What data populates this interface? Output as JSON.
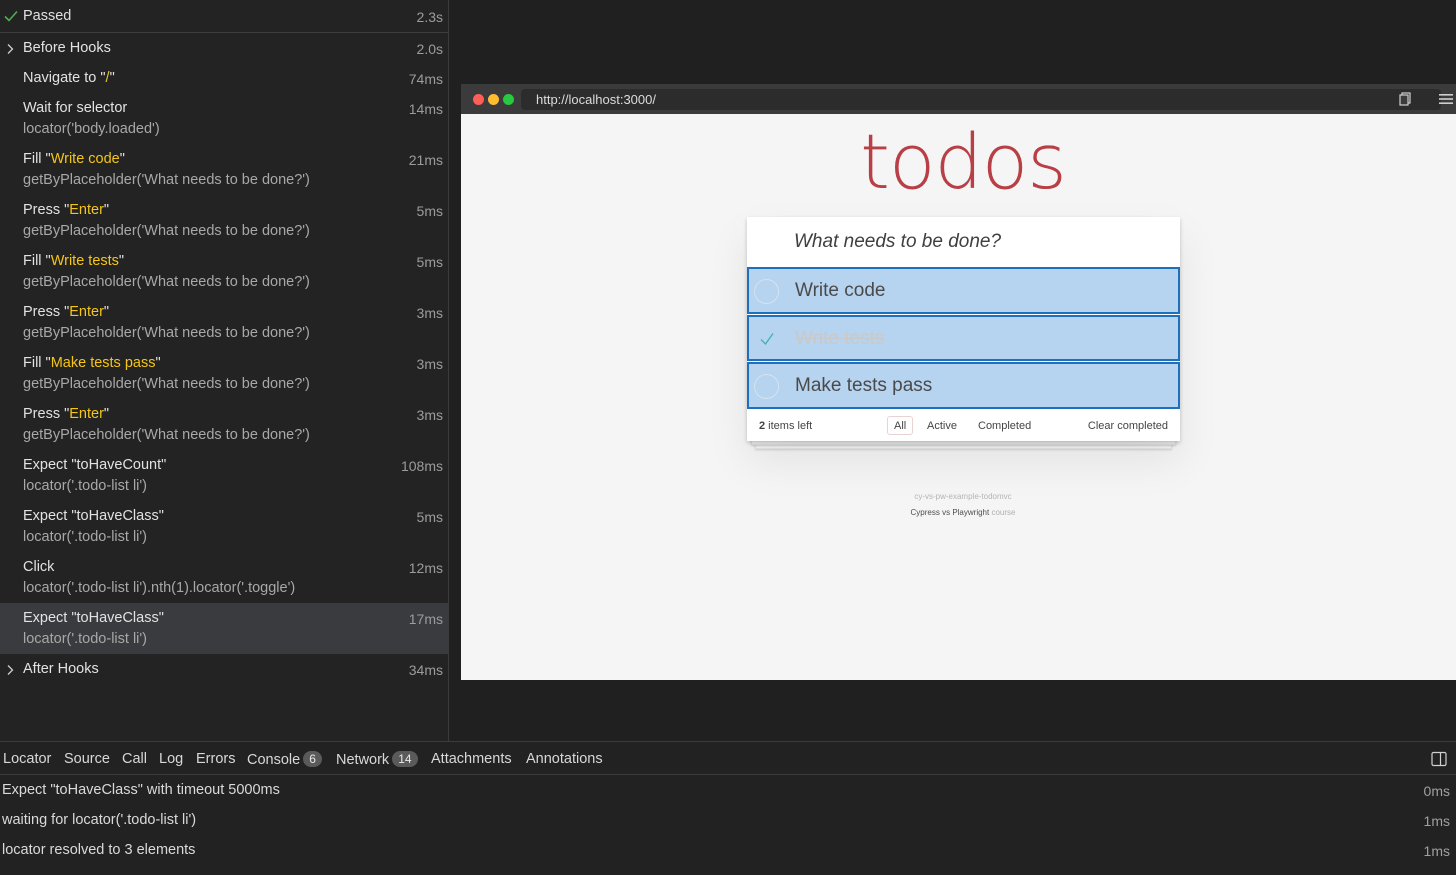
{
  "status": {
    "label": "Passed",
    "duration": "2.3s",
    "color": "#4caf50"
  },
  "actions": [
    {
      "title": "Before Hooks",
      "duration": "2.0s",
      "expandable": true
    },
    {
      "title_parts": [
        "Navigate to \"",
        "/",
        "\""
      ],
      "duration": "74ms"
    },
    {
      "title": "Wait for selector",
      "sub": "locator('body.loaded')",
      "duration": "14ms"
    },
    {
      "title_parts": [
        "Fill \"",
        "Write code",
        "\""
      ],
      "sub": "getByPlaceholder('What needs to be done?')",
      "duration": "21ms"
    },
    {
      "title_parts": [
        "Press \"",
        "Enter",
        "\""
      ],
      "sub": "getByPlaceholder('What needs to be done?')",
      "duration": "5ms"
    },
    {
      "title_parts": [
        "Fill \"",
        "Write tests",
        "\""
      ],
      "sub": "getByPlaceholder('What needs to be done?')",
      "duration": "5ms"
    },
    {
      "title_parts": [
        "Press \"",
        "Enter",
        "\""
      ],
      "sub": "getByPlaceholder('What needs to be done?')",
      "duration": "3ms"
    },
    {
      "title_parts": [
        "Fill \"",
        "Make tests pass",
        "\""
      ],
      "sub": "getByPlaceholder('What needs to be done?')",
      "duration": "3ms"
    },
    {
      "title_parts": [
        "Press \"",
        "Enter",
        "\""
      ],
      "sub": "getByPlaceholder('What needs to be done?')",
      "duration": "3ms"
    },
    {
      "title": "Expect \"toHaveCount\"",
      "sub": "locator('.todo-list li')",
      "duration": "108ms"
    },
    {
      "title": "Expect \"toHaveClass\"",
      "sub": "locator('.todo-list li')",
      "duration": "5ms"
    },
    {
      "title": "Click",
      "sub": "locator('.todo-list li').nth(1).locator('.toggle')",
      "duration": "12ms"
    },
    {
      "title": "Expect \"toHaveClass\"",
      "sub": "locator('.todo-list li')",
      "duration": "17ms",
      "selected": true
    },
    {
      "title": "After Hooks",
      "duration": "34ms",
      "expandable": true
    }
  ],
  "browser": {
    "url": "http://localhost:3000/",
    "app_title": "todos",
    "placeholder": "What needs to be done?",
    "todos": [
      {
        "text": "Write code",
        "completed": false
      },
      {
        "text": "Write tests",
        "completed": true
      },
      {
        "text": "Make tests pass",
        "completed": false
      }
    ],
    "items_left_count": "2",
    "items_left_suffix": " items left",
    "filters": [
      "All",
      "Active",
      "Completed"
    ],
    "active_filter": "All",
    "clear_completed": "Clear completed",
    "info_repo": "cy-vs-pw-example-todomvc",
    "info_course_name": "Cypress vs Playwright",
    "info_course_suffix": " course",
    "highlight_color": "#b6d3ef",
    "accent_color": "#b83f45"
  },
  "bottom_tabs": [
    {
      "label": "Locator"
    },
    {
      "label": "Source"
    },
    {
      "label": "Call"
    },
    {
      "label": "Log"
    },
    {
      "label": "Errors"
    },
    {
      "label": "Console",
      "badge": "6"
    },
    {
      "label": "Network",
      "badge": "14"
    },
    {
      "label": "Attachments"
    },
    {
      "label": "Annotations"
    }
  ],
  "log": [
    {
      "text": "Expect \"toHaveClass\" with timeout 5000ms",
      "time": "0ms"
    },
    {
      "text": "waiting for locator('.todo-list li')",
      "time": "1ms"
    },
    {
      "text": "locator resolved to 3 elements",
      "time": "1ms"
    }
  ],
  "icons": {
    "status": "check-icon",
    "expand": "chevron-right-icon",
    "copy": "copy-icon",
    "menu": "hamburger-icon",
    "sidebar": "sidebar-toggle-icon"
  }
}
